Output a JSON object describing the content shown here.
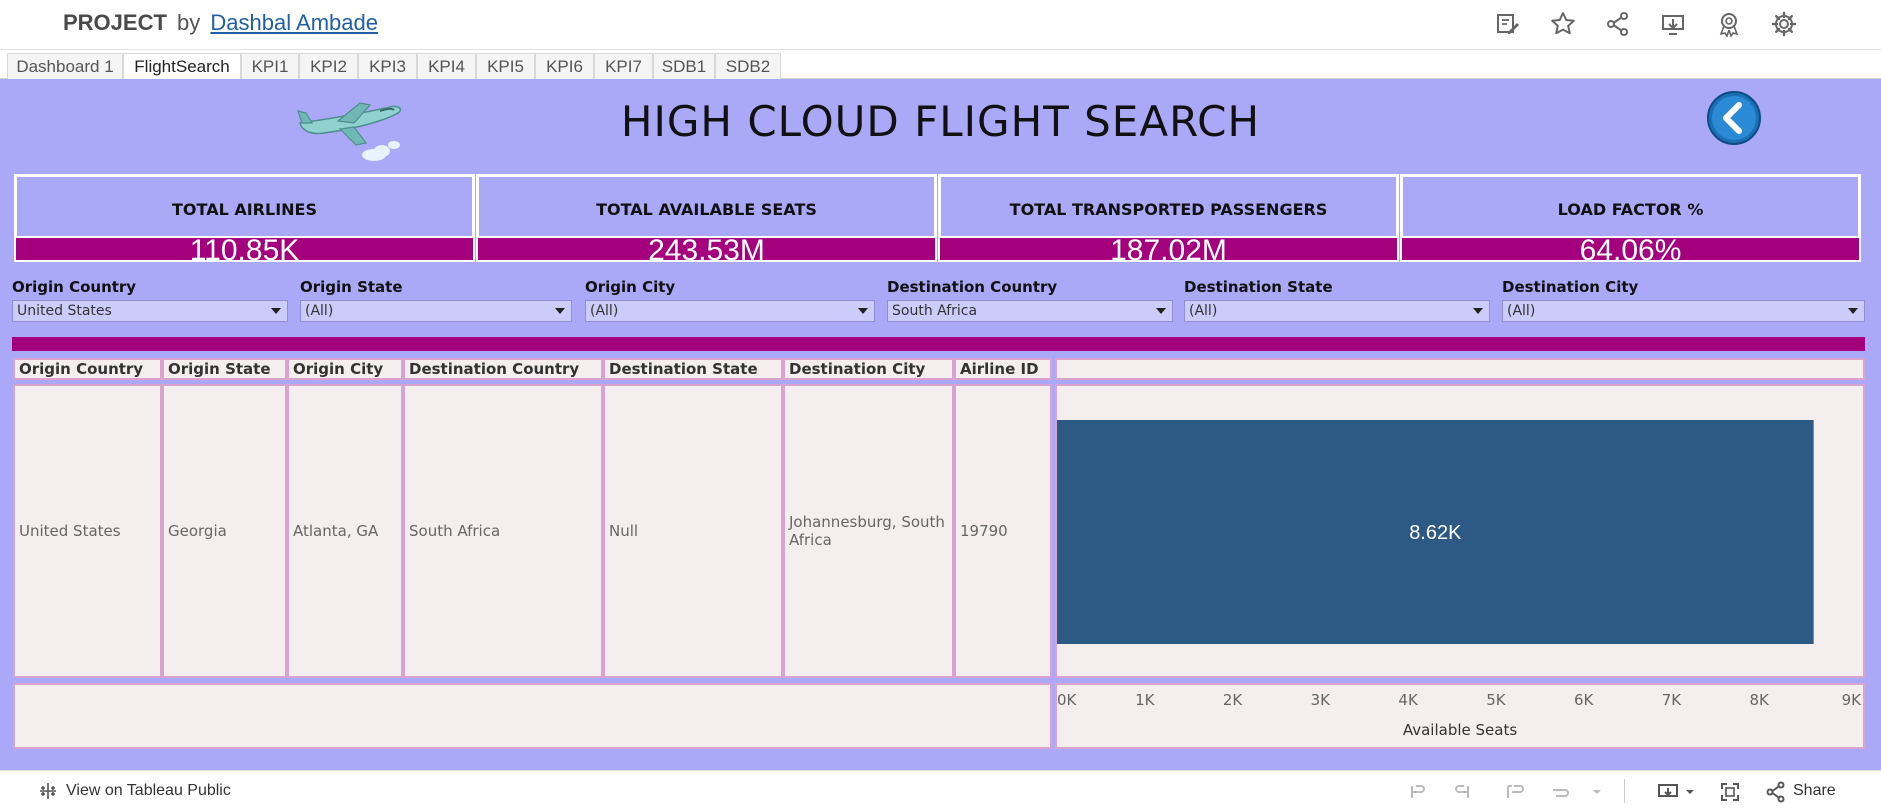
{
  "header": {
    "project": "PROJECT",
    "by": "by",
    "author": "Dashbal Ambade",
    "icons": [
      "edit-data-icon",
      "star-icon",
      "share-icon",
      "download-icon",
      "badge-icon",
      "gear-icon"
    ]
  },
  "tabs": [
    {
      "label": "Dashboard 1",
      "active": false
    },
    {
      "label": "FlightSearch",
      "active": true
    },
    {
      "label": "KPI1",
      "active": false
    },
    {
      "label": "KPI2",
      "active": false
    },
    {
      "label": "KPI3",
      "active": false
    },
    {
      "label": "KPI4",
      "active": false
    },
    {
      "label": "KPI5",
      "active": false
    },
    {
      "label": "KPI6",
      "active": false
    },
    {
      "label": "KPI7",
      "active": false
    },
    {
      "label": "SDB1",
      "active": false
    },
    {
      "label": "SDB2",
      "active": false
    }
  ],
  "dashboard": {
    "title": "HIGH CLOUD FLIGHT SEARCH",
    "background": "#a9a9f8",
    "accent": "#a4007e"
  },
  "kpis": [
    {
      "label": "TOTAL AIRLINES",
      "value": "110.85K"
    },
    {
      "label": "TOTAL AVAILABLE SEATS",
      "value": "243.53M"
    },
    {
      "label": "TOTAL TRANSPORTED PASSENGERS",
      "value": "187.02M"
    },
    {
      "label": "LOAD FACTOR %",
      "value": "64.06%"
    }
  ],
  "filters": [
    {
      "label": "Origin Country",
      "value": "United States"
    },
    {
      "label": "Origin State",
      "value": "(All)"
    },
    {
      "label": "Origin City",
      "value": "(All)"
    },
    {
      "label": "Destination Country",
      "value": "South Africa"
    },
    {
      "label": "Destination  State",
      "value": "(All)"
    },
    {
      "label": "Destination City",
      "value": "(All)"
    }
  ],
  "table": {
    "headers": [
      "Origin Country",
      "Origin State",
      "Origin City",
      "Destination Country",
      "Destination  State",
      "Destination City",
      "Airline ID"
    ],
    "row": [
      "United States",
      "Georgia",
      "Atlanta, GA",
      "South Africa",
      "Null",
      "Johannesburg, South Africa",
      "19790"
    ]
  },
  "chart_data": {
    "type": "bar",
    "orientation": "horizontal",
    "categories": [
      "19790"
    ],
    "values": [
      8620
    ],
    "value_labels": [
      "8.62K"
    ],
    "xlabel": "Available Seats",
    "xlim": [
      0,
      9000
    ],
    "ticks": [
      "0K",
      "1K",
      "2K",
      "3K",
      "4K",
      "5K",
      "6K",
      "7K",
      "8K",
      "9K"
    ],
    "bar_color": "#2d5985"
  },
  "footer": {
    "view_public": "View on Tableau Public",
    "share": "Share"
  }
}
